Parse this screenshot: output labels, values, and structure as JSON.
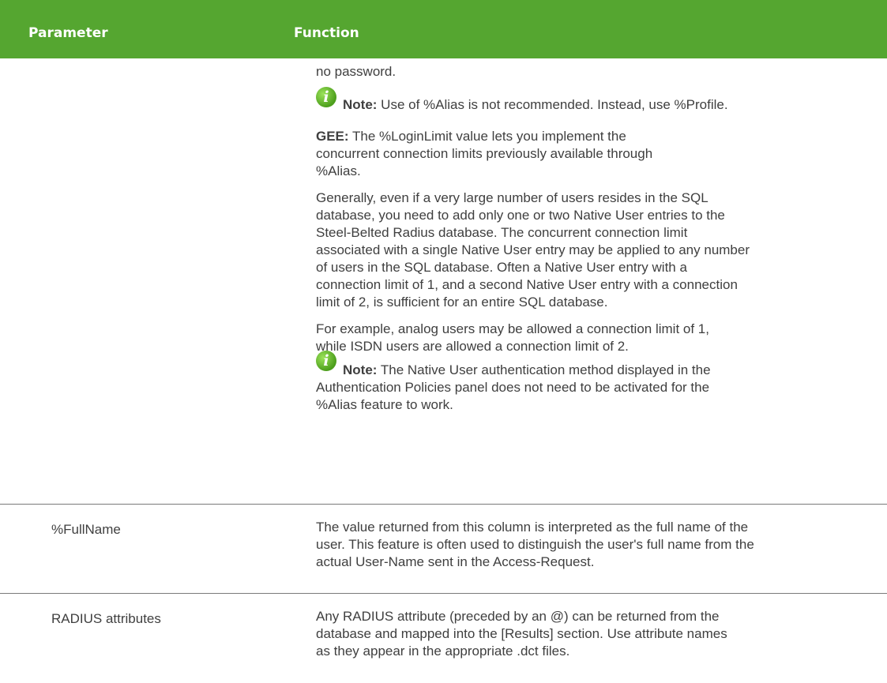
{
  "header": {
    "parameter": "Parameter",
    "function": "Function"
  },
  "row1": {
    "continuation": "no password.",
    "note1": {
      "label": "Note:",
      "text": " Use of %Alias is not recommended. Instead, use %Profile."
    },
    "gee": {
      "label": "GEE:",
      "line1": " The %LoginLimit value lets you implement the",
      "line2": "concurrent connection limits previously available through",
      "line3": "%Alias."
    },
    "generally": [
      "Generally, even if a very large number of users resides in the SQL",
      "database, you need to add only one or two Native User entries to the",
      "Steel-Belted Radius database. The concurrent connection limit",
      "associated with a single Native User entry may be applied to any number",
      "of users in the SQL database. Often a Native User entry with a",
      "connection limit of 1, and a second Native User entry with a connection",
      "limit of 2, is sufficient for an entire SQL database."
    ],
    "example": [
      "For example, analog users may be allowed a connection limit of 1,",
      "while ISDN users are allowed a connection limit of 2."
    ],
    "note2": {
      "label": "Note:",
      "line1": " The Native User authentication method displayed in the",
      "line2": "Authentication Policies panel does not need to be activated for the",
      "line3": "%Alias feature to work."
    }
  },
  "row2": {
    "parameter": "%FullName",
    "lines": [
      "The value returned from this column is interpreted as the full name of the",
      "user. This feature is often used to distinguish the user's full name from the",
      "actual User-Name sent in the Access-Request."
    ]
  },
  "row3": {
    "parameter": "RADIUS attributes",
    "lines": [
      "Any RADIUS attribute (preceded by an @) can be returned from the",
      "database and mapped into the [Results] section. Use attribute names",
      "as they appear in the appropriate .dct files."
    ]
  },
  "colors": {
    "header_bg": "#55a630",
    "note_icon": "#4c9e1c"
  },
  "icons": {
    "note": "info-icon"
  }
}
